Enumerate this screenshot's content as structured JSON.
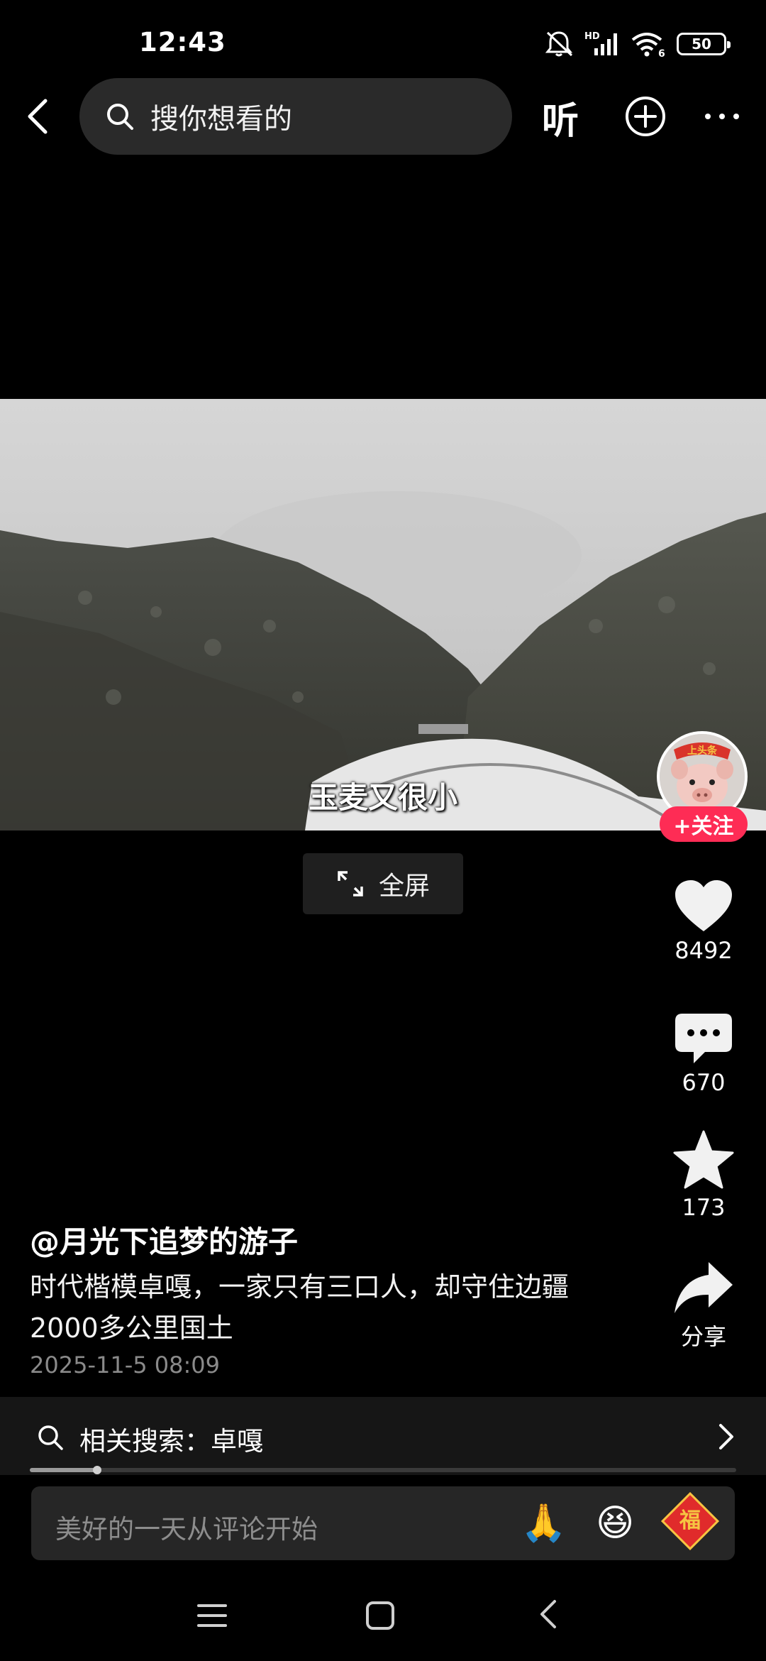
{
  "status_bar": {
    "time": "12:43",
    "network_label": "HD",
    "wifi_label": "6",
    "battery": "50"
  },
  "top_nav": {
    "search_placeholder": "搜你想看的",
    "listen_label": "听"
  },
  "video": {
    "subtitle": "玉麦又很小",
    "fullscreen_label": "全屏"
  },
  "rail": {
    "follow_label": "+关注",
    "avatar_badge": "上头条",
    "like_count": "8492",
    "comment_count": "670",
    "favorite_count": "173",
    "share_label": "分享"
  },
  "post": {
    "author": "@月光下追梦的游子",
    "caption": "时代楷模卓嘎，一家只有三口人，却守住边疆2000多公里国土",
    "date": "2025-11-5 08:09"
  },
  "related": {
    "label": "相关搜索：卓嘎"
  },
  "progress": {
    "fraction": 0.095
  },
  "comment_bar": {
    "placeholder": "美好的一天从评论开始",
    "emojis": [
      "🙏",
      "😆"
    ],
    "fu_label": "福"
  },
  "colors": {
    "accent": "#fe2c55",
    "background": "#000000"
  },
  "icons": [
    "back-icon",
    "search-icon",
    "add-circle-icon",
    "more-icon",
    "heart-icon",
    "comment-icon",
    "star-icon",
    "share-icon",
    "expand-icon",
    "chevron-right-icon",
    "menu-icon",
    "home-icon",
    "nav-back-icon"
  ]
}
